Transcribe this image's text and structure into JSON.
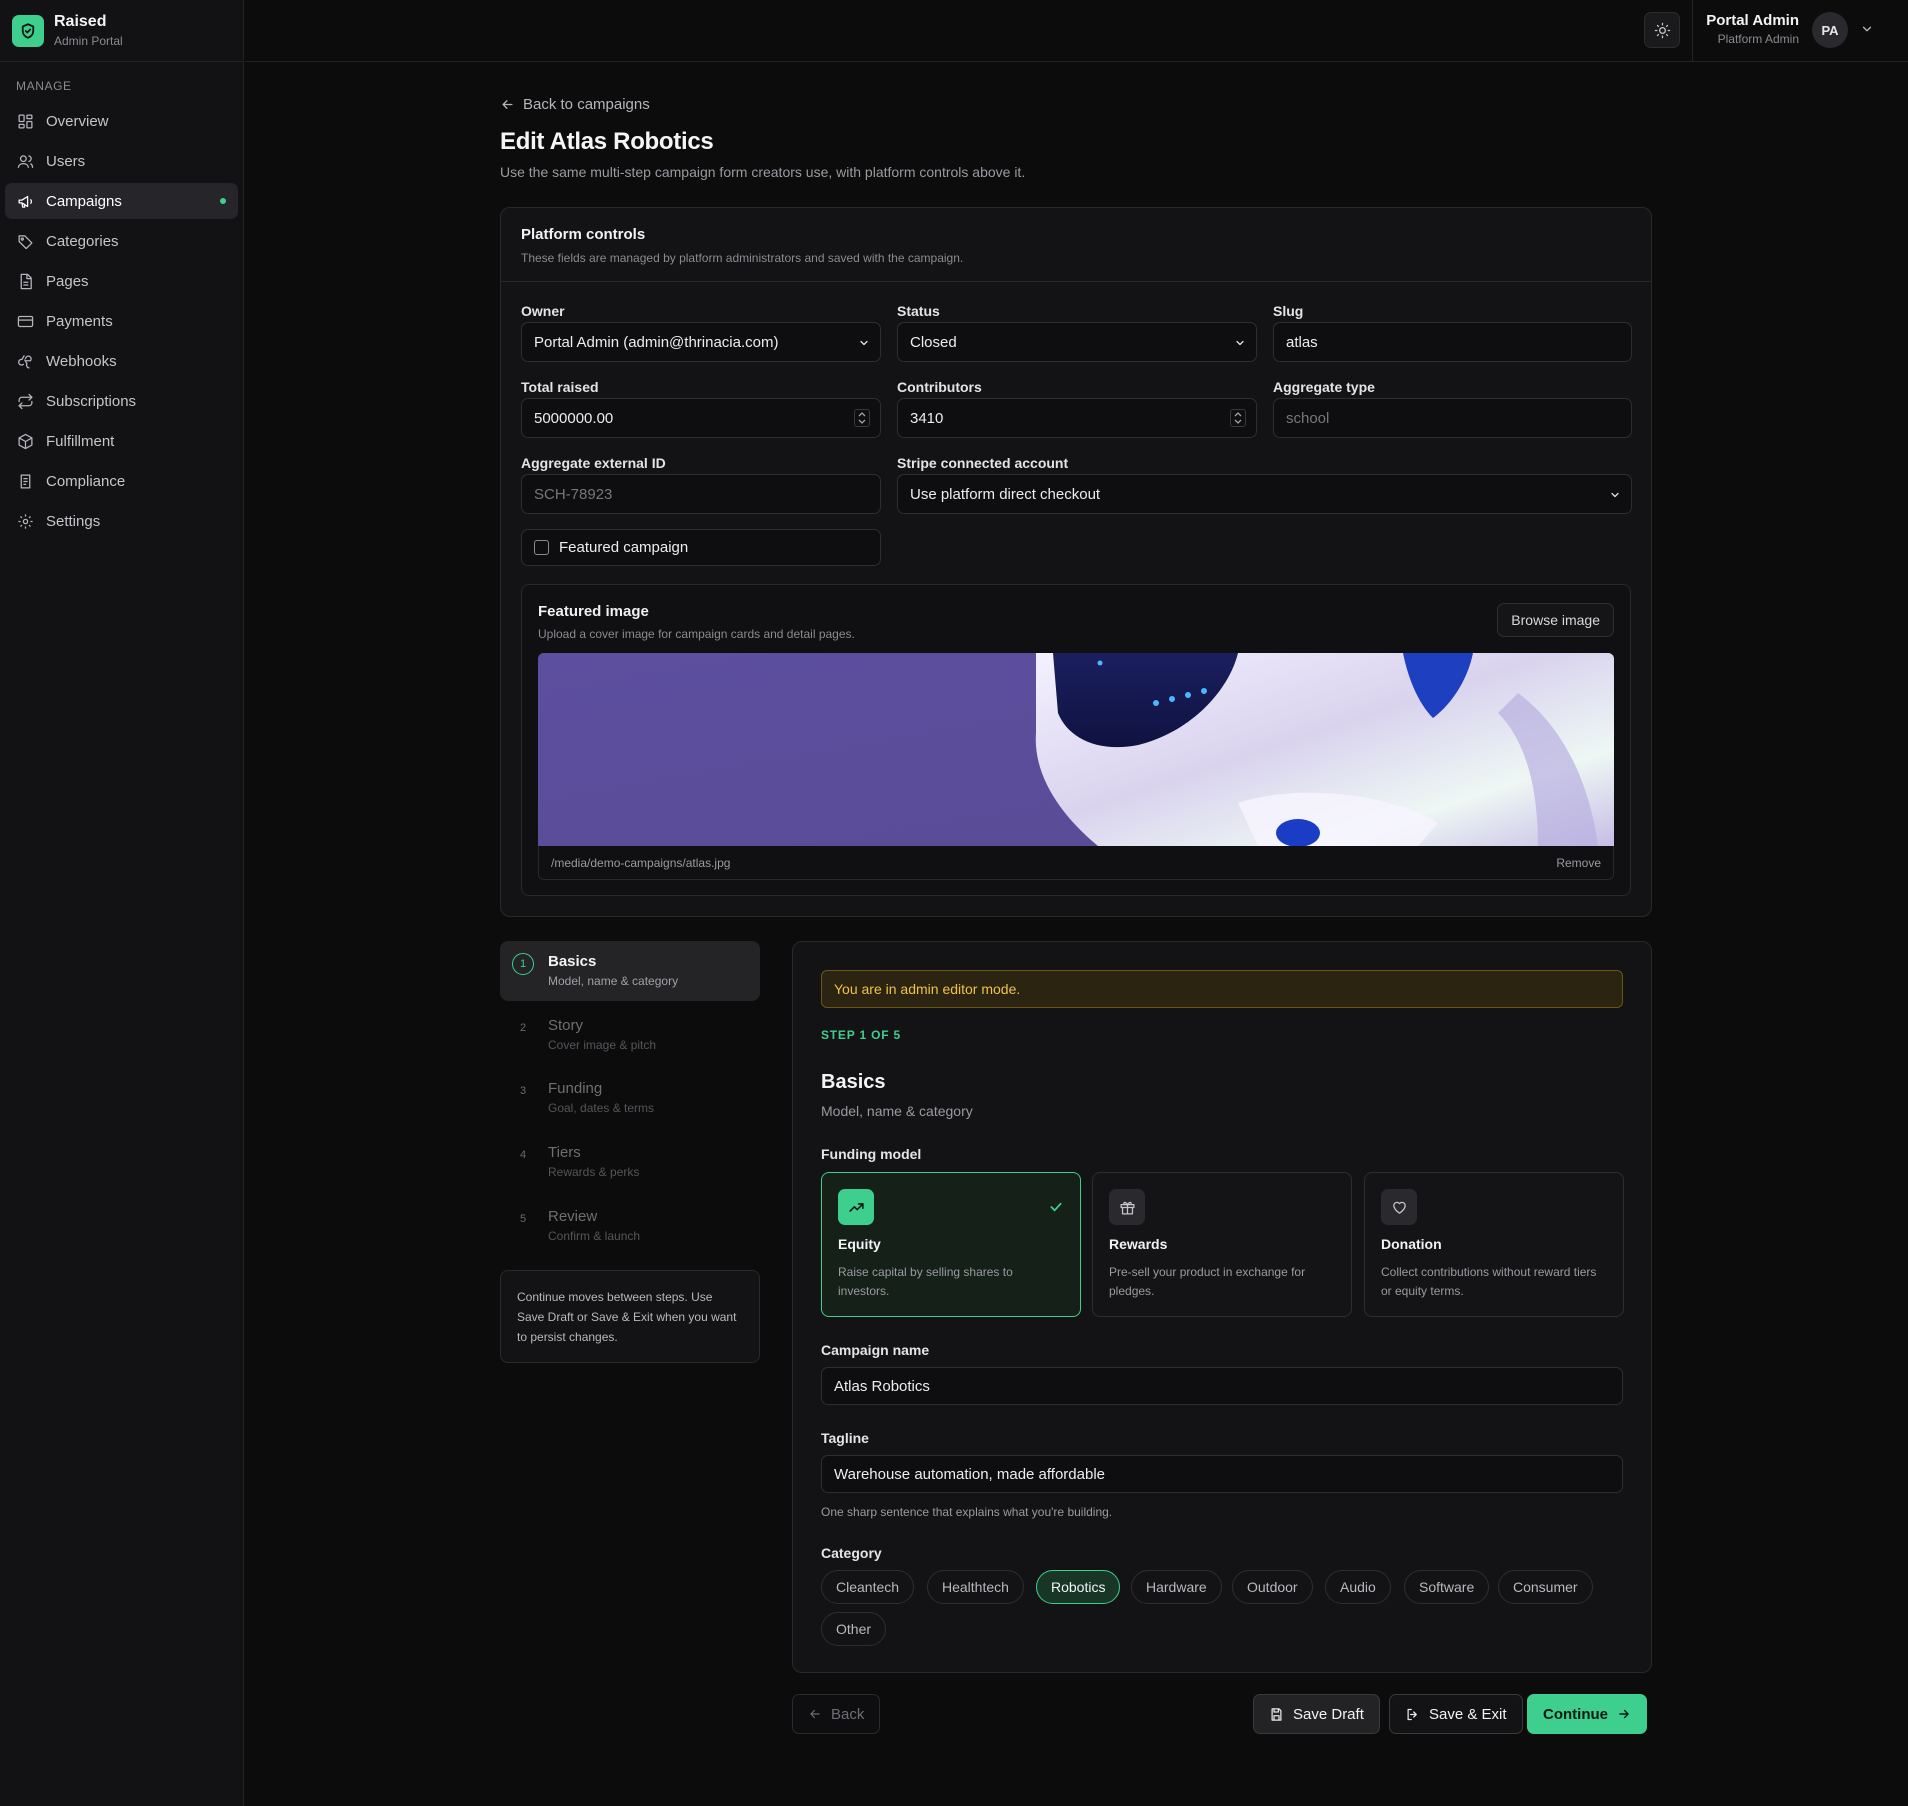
{
  "app": {
    "name": "Raised",
    "subtitle": "Admin Portal"
  },
  "sidebar": {
    "heading": "MANAGE",
    "items": [
      {
        "label": "Overview",
        "icon": "grid-icon"
      },
      {
        "label": "Users",
        "icon": "users-icon"
      },
      {
        "label": "Campaigns",
        "icon": "megaphone-icon",
        "active": true
      },
      {
        "label": "Categories",
        "icon": "tag-icon"
      },
      {
        "label": "Pages",
        "icon": "file-icon"
      },
      {
        "label": "Payments",
        "icon": "credit-card-icon"
      },
      {
        "label": "Webhooks",
        "icon": "webhook-icon"
      },
      {
        "label": "Subscriptions",
        "icon": "repeat-icon"
      },
      {
        "label": "Fulfillment",
        "icon": "package-icon"
      },
      {
        "label": "Compliance",
        "icon": "clipboard-icon"
      },
      {
        "label": "Settings",
        "icon": "gear-icon"
      }
    ]
  },
  "header": {
    "user_name": "Portal Admin",
    "user_role": "Platform Admin",
    "avatar_initials": "PA"
  },
  "page": {
    "back_label": "Back to campaigns",
    "title": "Edit Atlas Robotics",
    "subtitle": "Use the same multi-step campaign form creators use, with platform controls above it."
  },
  "platform_controls": {
    "title": "Platform controls",
    "subtitle": "These fields are managed by platform administrators and saved with the campaign.",
    "owner": {
      "label": "Owner",
      "value": "Portal Admin (admin@thrinacia.com)"
    },
    "status": {
      "label": "Status",
      "value": "Closed"
    },
    "slug": {
      "label": "Slug",
      "value": "atlas"
    },
    "total_raised": {
      "label": "Total raised",
      "value": "5000000.00"
    },
    "contributors": {
      "label": "Contributors",
      "value": "3410"
    },
    "aggregate_type": {
      "label": "Aggregate type",
      "placeholder": "school"
    },
    "aggregate_external_id": {
      "label": "Aggregate external ID",
      "placeholder": "SCH-78923"
    },
    "stripe_account": {
      "label": "Stripe connected account",
      "value": "Use platform direct checkout"
    },
    "featured": {
      "label": "Featured campaign",
      "checked": false
    },
    "featured_image": {
      "title": "Featured image",
      "subtitle": "Upload a cover image for campaign cards and detail pages.",
      "browse_label": "Browse image",
      "path": "/media/demo-campaigns/atlas.jpg",
      "remove_label": "Remove"
    }
  },
  "steps": [
    {
      "num": "1",
      "title": "Basics",
      "desc": "Model, name & category",
      "active": true
    },
    {
      "num": "2",
      "title": "Story",
      "desc": "Cover image & pitch"
    },
    {
      "num": "3",
      "title": "Funding",
      "desc": "Goal, dates & terms"
    },
    {
      "num": "4",
      "title": "Tiers",
      "desc": "Rewards & perks"
    },
    {
      "num": "5",
      "title": "Review",
      "desc": "Confirm & launch"
    }
  ],
  "steps_note": "Continue moves between steps. Use Save Draft or Save & Exit when you want to persist changes.",
  "form": {
    "banner": "You are in admin editor mode.",
    "step_label": "STEP 1 OF 5",
    "title": "Basics",
    "subtitle": "Model, name & category",
    "funding_model_label": "Funding model",
    "models": [
      {
        "name": "Equity",
        "desc": "Raise capital by selling shares to investors.",
        "icon": "trending-up-icon",
        "selected": true
      },
      {
        "name": "Rewards",
        "desc": "Pre-sell your product in exchange for pledges.",
        "icon": "gift-icon"
      },
      {
        "name": "Donation",
        "desc": "Collect contributions without reward tiers or equity terms.",
        "icon": "heart-icon"
      }
    ],
    "campaign_name": {
      "label": "Campaign name",
      "value": "Atlas Robotics"
    },
    "tagline": {
      "label": "Tagline",
      "value": "Warehouse automation, made affordable",
      "helper": "One sharp sentence that explains what you're building."
    },
    "category_label": "Category",
    "categories": [
      "Cleantech",
      "Healthtech",
      "Robotics",
      "Hardware",
      "Outdoor",
      "Audio",
      "Software",
      "Consumer",
      "Other"
    ],
    "selected_category": "Robotics"
  },
  "actions": {
    "back": "Back",
    "save_draft": "Save Draft",
    "save_exit": "Save & Exit",
    "continue": "Continue"
  },
  "colors": {
    "accent": "#3ecf8e",
    "background": "#0c0c0d",
    "banner_text": "#f0c14b"
  }
}
